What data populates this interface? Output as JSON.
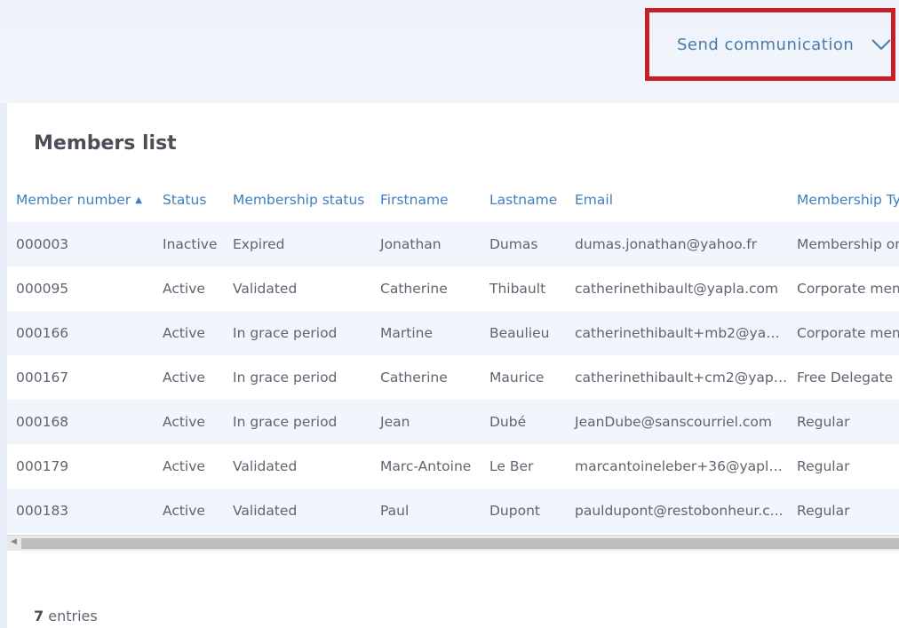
{
  "header": {
    "send_communication_label": "Send communication",
    "chevron_icon": "chevron-down-icon"
  },
  "members": {
    "title": "Members list",
    "columns": [
      "Member number",
      "Status",
      "Membership status",
      "Firstname",
      "Lastname",
      "Email",
      "Membership Ty"
    ],
    "sort_icon": "sort-ascending-icon",
    "rows": [
      [
        "000003",
        "Inactive",
        "Expired",
        "Jonathan",
        "Dumas",
        "dumas.jonathan@yahoo.fr",
        "Membership org"
      ],
      [
        "000095",
        "Active",
        "Validated",
        "Catherine",
        "Thibault",
        "catherinethibault@yapla.com",
        "Corporate mem"
      ],
      [
        "000166",
        "Active",
        "In grace period",
        "Martine",
        "Beaulieu",
        "catherinethibault+mb2@yapl...",
        "Corporate mem"
      ],
      [
        "000167",
        "Active",
        "In grace period",
        "Catherine",
        "Maurice",
        "catherinethibault+cm2@yapl...",
        "Free Delegate"
      ],
      [
        "000168",
        "Active",
        "In grace period",
        "Jean",
        "Dubé",
        "JeanDube@sanscourriel.com",
        "Regular"
      ],
      [
        "000179",
        "Active",
        "Validated",
        "Marc-Antoine",
        "Le Ber",
        "marcantoineleber+36@yapla...",
        "Regular"
      ],
      [
        "000183",
        "Active",
        "Validated",
        "Paul",
        "Dupont",
        "pauldupont@restobonheur.c...",
        "Regular"
      ]
    ],
    "entries_count": "7",
    "entries_label": "entries"
  },
  "colors": {
    "accent": "#3e7fbf",
    "highlight_border": "#c61f26"
  }
}
